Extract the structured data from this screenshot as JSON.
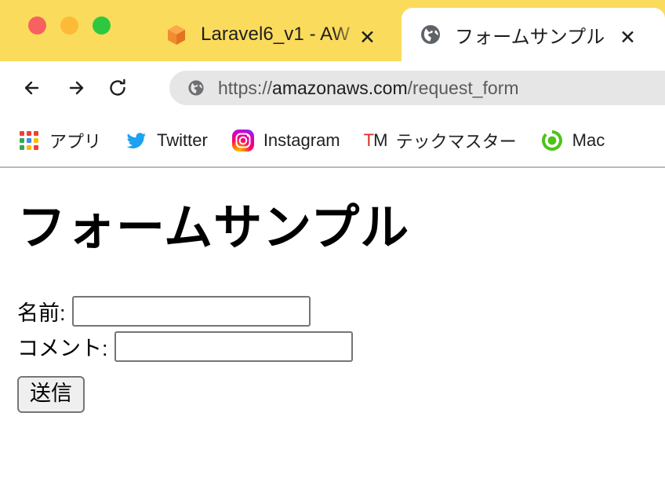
{
  "window": {
    "controls": [
      {
        "name": "close",
        "color": "#f7615f"
      },
      {
        "name": "minimize",
        "color": "#fbbb37"
      },
      {
        "name": "maximize",
        "color": "#2ec840"
      }
    ],
    "titlebar_color": "#fbdb5c"
  },
  "tabs": [
    {
      "title": "Laravel6_v1 - AW",
      "favicon": "aws-cube-icon",
      "close_label": "✕",
      "active": false
    },
    {
      "title": "フォームサンプル",
      "favicon": "globe-icon",
      "close_label": "✕",
      "active": true
    }
  ],
  "toolbar": {
    "back_label": "←",
    "forward_label": "→",
    "reload_label": "↻",
    "omnibox": {
      "favicon": "globe-icon",
      "scheme": "https://",
      "host": "amazonaws.com",
      "path": "/request_form",
      "full_url": "https://amazonaws.com/request_form"
    }
  },
  "bookmarks": [
    {
      "label": "アプリ",
      "icon": "google-apps-grid-icon"
    },
    {
      "label": "Twitter",
      "icon": "twitter-bird-icon"
    },
    {
      "label": "Instagram",
      "icon": "instagram-icon"
    },
    {
      "label": "テックマスター",
      "icon": "tm-icon",
      "icon_text_1": "T",
      "icon_text_2": "M"
    },
    {
      "label": "Mac",
      "icon": "green-circle-icon"
    }
  ],
  "page": {
    "heading": "フォームサンプル",
    "form": {
      "fields": [
        {
          "label": "名前:",
          "value": "",
          "placeholder": ""
        },
        {
          "label": "コメント:",
          "value": "",
          "placeholder": ""
        }
      ],
      "submit_label": "送信"
    }
  },
  "colors": {
    "titlebar": "#fbdb5c",
    "omnibox_bg": "#e6e6e6",
    "page_bg": "#ffffff",
    "text": "#000000"
  }
}
